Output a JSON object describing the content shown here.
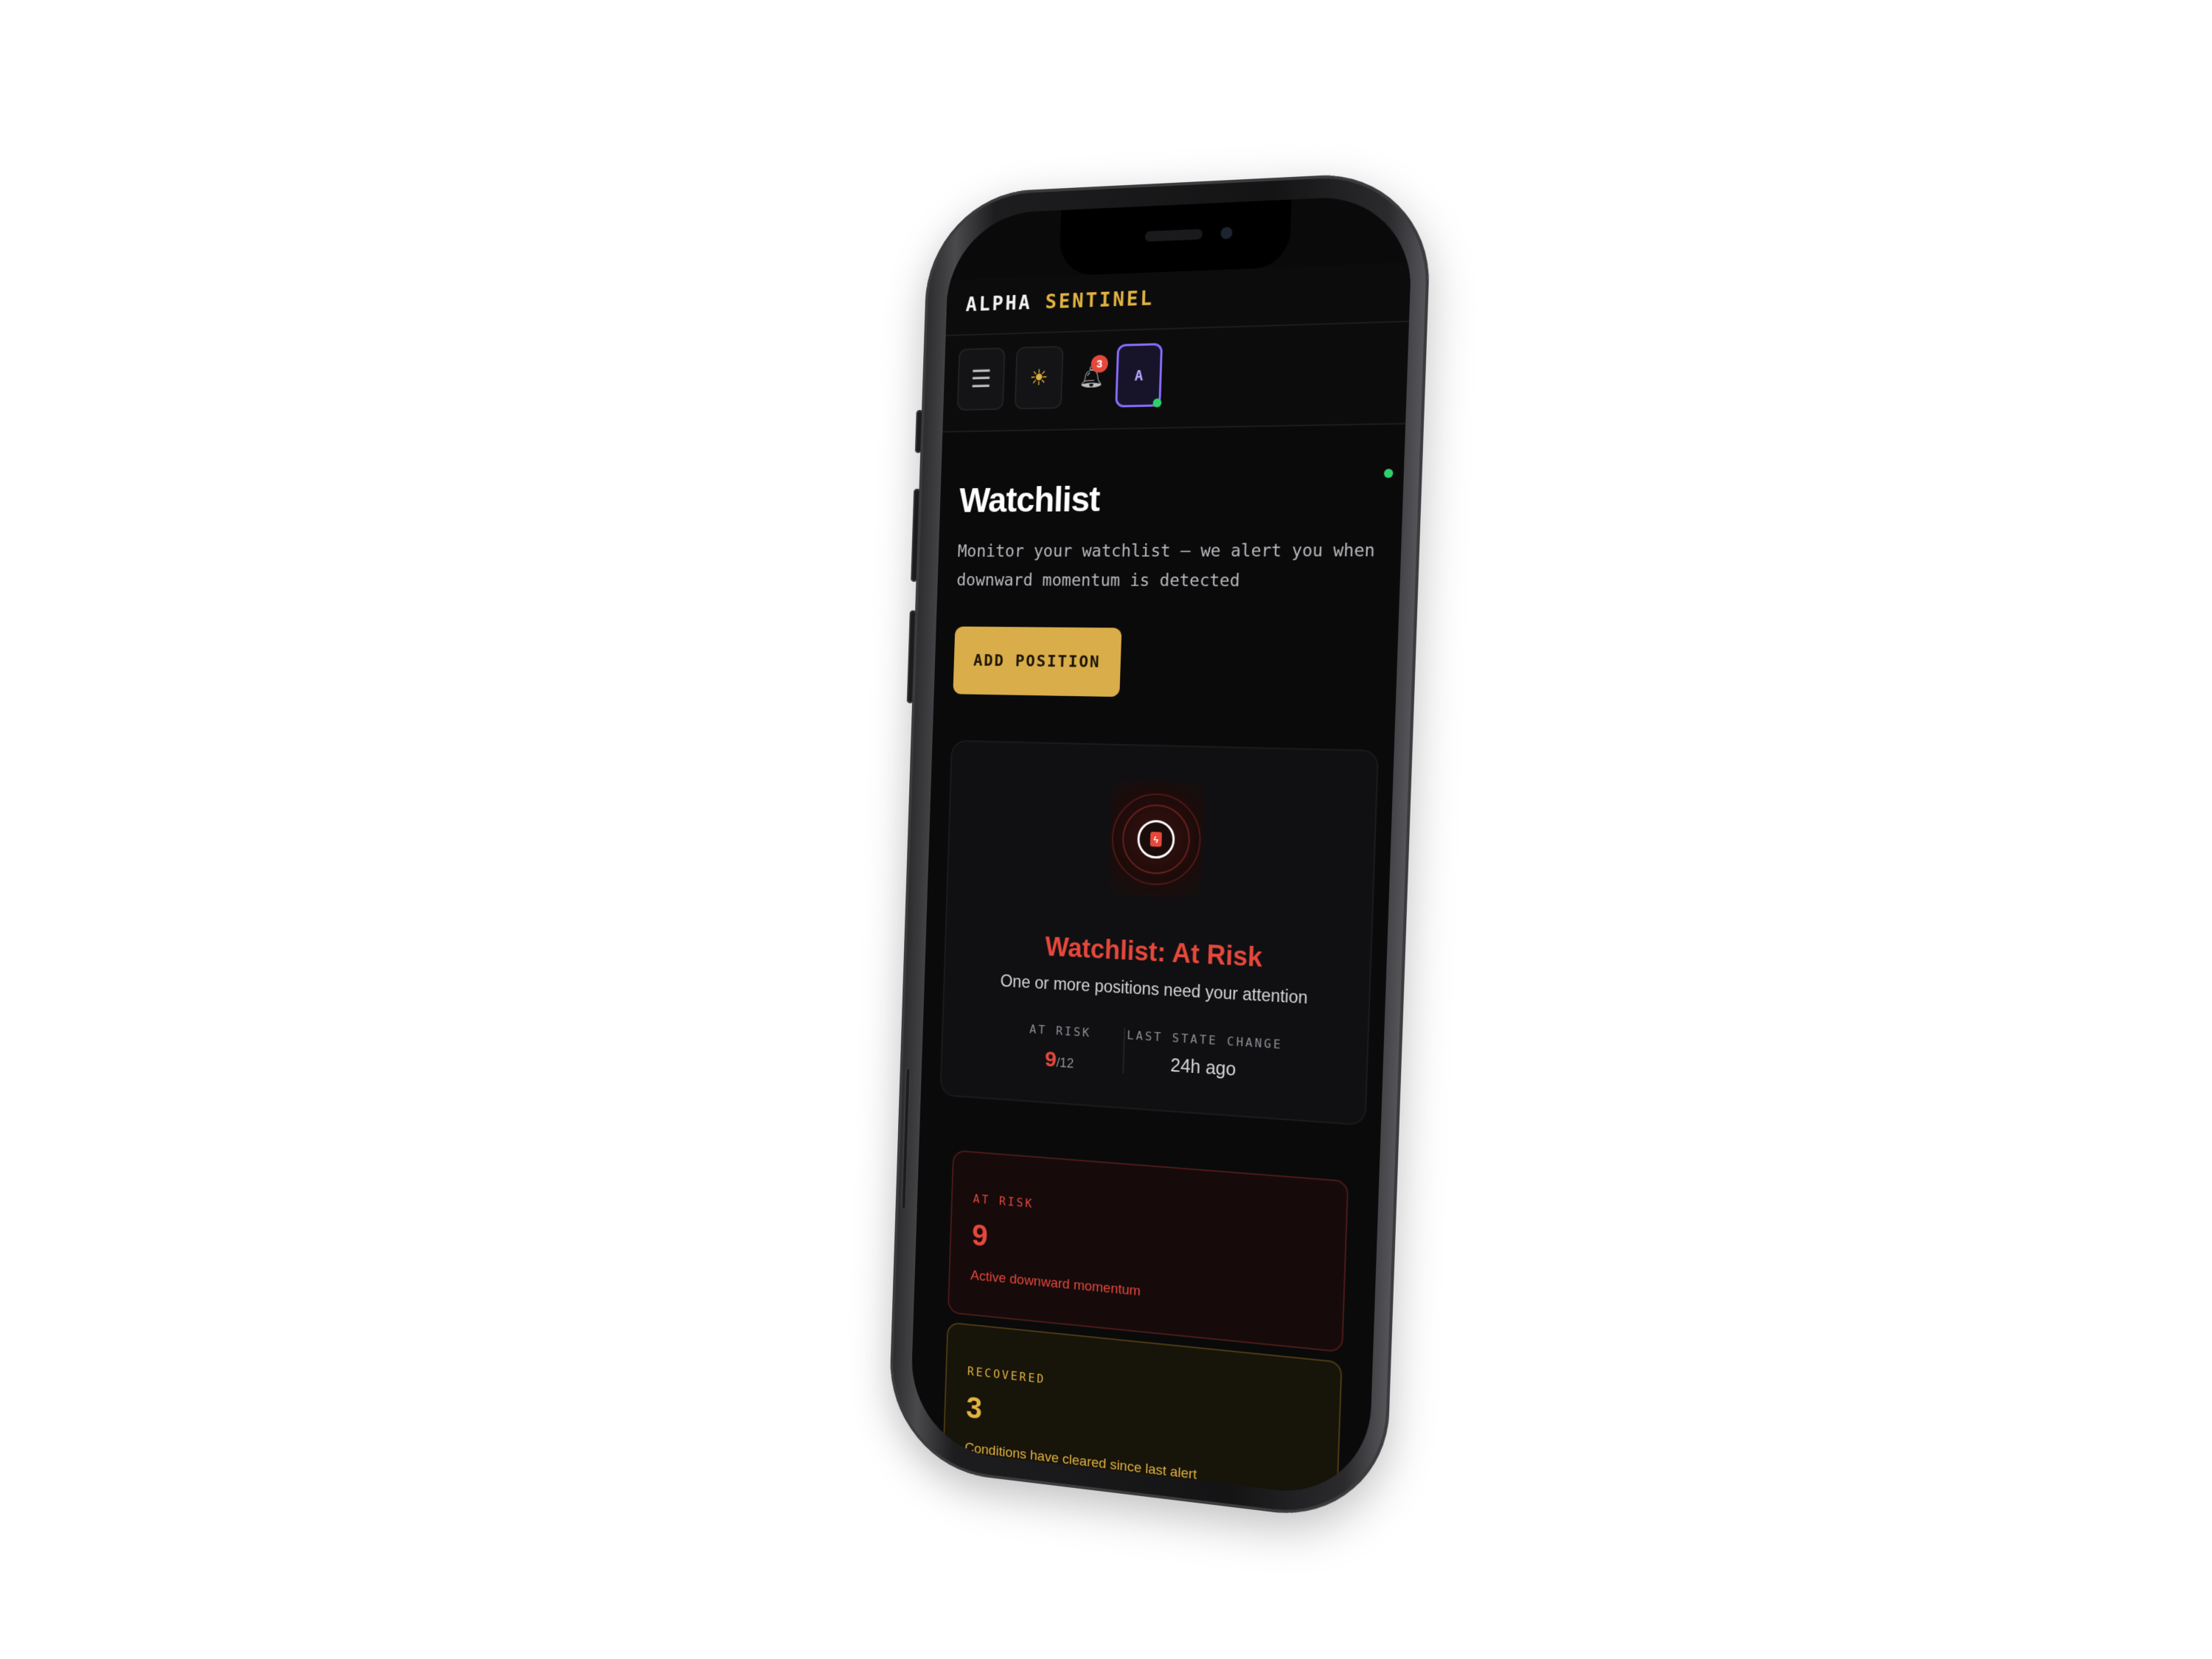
{
  "brand": {
    "name_part1": "ALPHA",
    "name_part2": "SENTINEL"
  },
  "header": {
    "menu_icon": "menu-icon",
    "theme_icon": "sun-icon",
    "notifications": {
      "icon": "bell-icon",
      "count": "3"
    },
    "avatar_initial": "A"
  },
  "page": {
    "title": "Watchlist",
    "subtitle": "Monitor your watchlist — we alert you when downward momentum is detected",
    "add_button_label": "ADD POSITION"
  },
  "status": {
    "title": "Watchlist: At Risk",
    "subtitle": "One or more positions need your attention",
    "at_risk_label": "AT RISK",
    "at_risk_value": "9",
    "at_risk_total": "/12",
    "last_change_label": "LAST STATE CHANGE",
    "last_change_value": "24h ago"
  },
  "metrics": [
    {
      "label": "AT RISK",
      "value": "9",
      "description": "Active downward momentum"
    },
    {
      "label": "RECOVERED",
      "value": "3",
      "description": "Conditions have cleared since last alert"
    }
  ],
  "colors": {
    "accent_gold": "#e3b341",
    "risk_red": "#e5483b",
    "online_green": "#2ed16b",
    "avatar_purple": "#8a6cff"
  }
}
